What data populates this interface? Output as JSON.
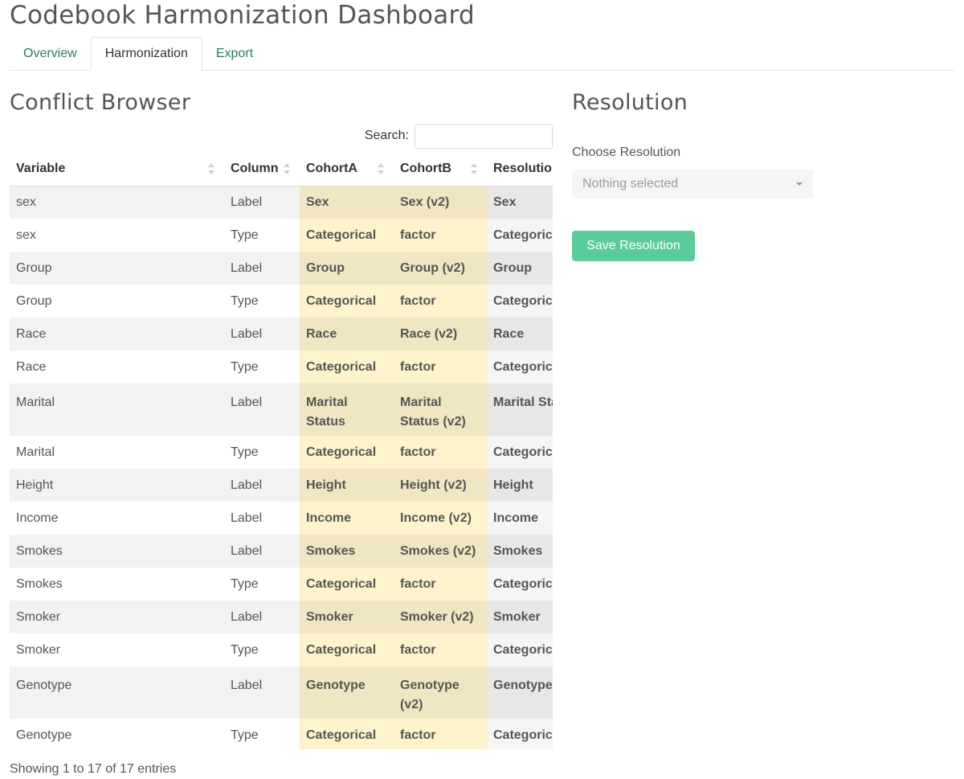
{
  "app": {
    "title": "Codebook Harmonization Dashboard"
  },
  "tabs": [
    {
      "label": "Overview"
    },
    {
      "label": "Harmonization"
    },
    {
      "label": "Export"
    }
  ],
  "browser": {
    "heading": "Conflict Browser",
    "search_label": "Search:",
    "search_value": "",
    "columns": [
      "Variable",
      "Column",
      "CohortA",
      "CohortB",
      "Resolution"
    ],
    "rows": [
      {
        "variable": "sex",
        "column": "Label",
        "cohort_a": "Sex",
        "cohort_b": "Sex (v2)",
        "resolution": "Sex"
      },
      {
        "variable": "sex",
        "column": "Type",
        "cohort_a": "Categorical",
        "cohort_b": "factor",
        "resolution": "Categorical"
      },
      {
        "variable": "Group",
        "column": "Label",
        "cohort_a": "Group",
        "cohort_b": "Group (v2)",
        "resolution": "Group"
      },
      {
        "variable": "Group",
        "column": "Type",
        "cohort_a": "Categorical",
        "cohort_b": "factor",
        "resolution": "Categorical"
      },
      {
        "variable": "Race",
        "column": "Label",
        "cohort_a": "Race",
        "cohort_b": "Race (v2)",
        "resolution": "Race"
      },
      {
        "variable": "Race",
        "column": "Type",
        "cohort_a": "Categorical",
        "cohort_b": "factor",
        "resolution": "Categorical"
      },
      {
        "variable": "Marital",
        "column": "Label",
        "cohort_a": "Marital Status",
        "cohort_b": "Marital Status (v2)",
        "resolution": "Marital Status"
      },
      {
        "variable": "Marital",
        "column": "Type",
        "cohort_a": "Categorical",
        "cohort_b": "factor",
        "resolution": "Categorical"
      },
      {
        "variable": "Height",
        "column": "Label",
        "cohort_a": "Height",
        "cohort_b": "Height (v2)",
        "resolution": "Height"
      },
      {
        "variable": "Income",
        "column": "Label",
        "cohort_a": "Income",
        "cohort_b": "Income (v2)",
        "resolution": "Income"
      },
      {
        "variable": "Smokes",
        "column": "Label",
        "cohort_a": "Smokes",
        "cohort_b": "Smokes (v2)",
        "resolution": "Smokes"
      },
      {
        "variable": "Smokes",
        "column": "Type",
        "cohort_a": "Categorical",
        "cohort_b": "factor",
        "resolution": "Categorical"
      },
      {
        "variable": "Smoker",
        "column": "Label",
        "cohort_a": "Smoker",
        "cohort_b": "Smoker (v2)",
        "resolution": "Smoker"
      },
      {
        "variable": "Smoker",
        "column": "Type",
        "cohort_a": "Categorical",
        "cohort_b": "factor",
        "resolution": "Categorical"
      },
      {
        "variable": "Genotype",
        "column": "Label",
        "cohort_a": "Genotype",
        "cohort_b": "Genotype (v2)",
        "resolution": "Genotype"
      },
      {
        "variable": "Genotype",
        "column": "Type",
        "cohort_a": "Categorical",
        "cohort_b": "factor",
        "resolution": "Categorical"
      }
    ],
    "footer": "Showing 1 to 17 of 17 entries"
  },
  "resolution": {
    "heading": "Resolution",
    "choose_label": "Choose Resolution",
    "select_value": "Nothing selected",
    "save_label": "Save Resolution"
  },
  "colors": {
    "accent": "#5ccb9a",
    "tab_link": "#2a7a5b",
    "cohort_highlight": "#fef3cc"
  },
  "icons": {
    "sort": "sort-both-icon",
    "dropdown": "caret-down-icon"
  }
}
